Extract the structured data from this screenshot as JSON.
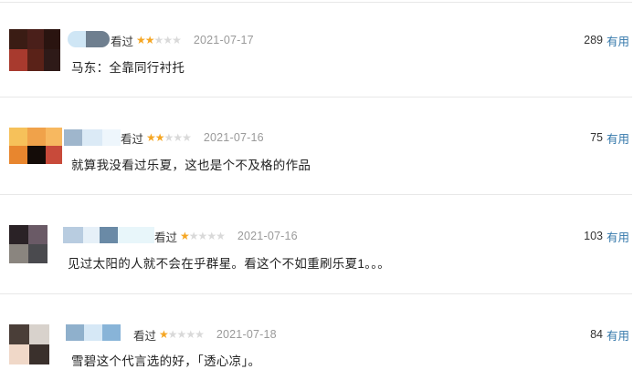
{
  "reviews": [
    {
      "status": "看过",
      "rating": 2,
      "date": "2021-07-17",
      "votes": "289",
      "useful_label": "有用",
      "content": "马东：全靠同行衬托"
    },
    {
      "status": "看过",
      "rating": 2,
      "date": "2021-07-16",
      "votes": "75",
      "useful_label": "有用",
      "content": "就算我没看过乐夏，这也是个不及格的作品"
    },
    {
      "status": "看过",
      "rating": 1,
      "date": "2021-07-16",
      "votes": "103",
      "useful_label": "有用",
      "content": "见过太阳的人就不会在乎群星。看这个不如重刷乐夏1。。。"
    },
    {
      "status": "看过",
      "rating": 1,
      "date": "2021-07-18",
      "votes": "84",
      "useful_label": "有用",
      "content": "雪碧这个代言选的好，「透心凉」。"
    }
  ],
  "colors": {
    "star_on": "#f5a623",
    "star_off": "#d9d9d9",
    "useful_link": "#3377aa",
    "date": "#9a9a9a"
  }
}
